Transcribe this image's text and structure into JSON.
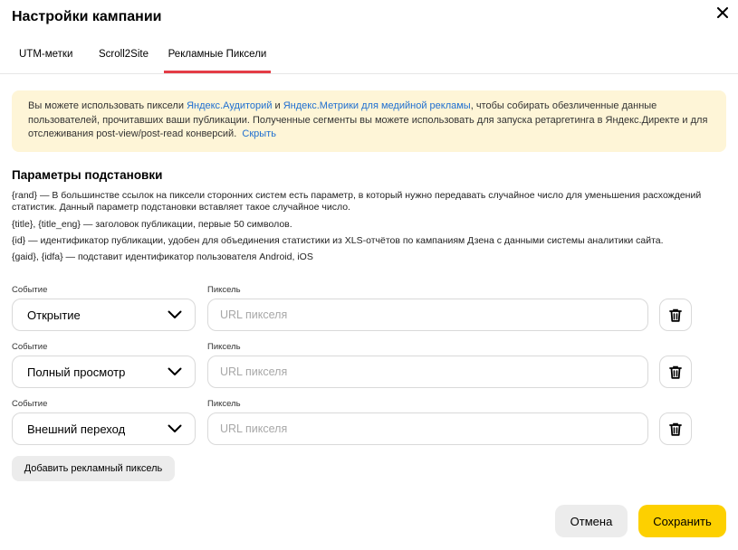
{
  "dialog": {
    "title": "Настройки кампании",
    "close_icon": "close-icon"
  },
  "tabs": [
    {
      "label": "UTM-метки",
      "active": false
    },
    {
      "label": "Scroll2Site",
      "active": false
    },
    {
      "label": "Рекламные Пиксели",
      "active": true
    }
  ],
  "info": {
    "text_1": "Вы можете использовать пиксели ",
    "link_audiences": "Яндекс.Аудиторий",
    "text_2": " и ",
    "link_metrika": "Яндекс.Метрики для медийной рекламы",
    "text_3": ", чтобы собирать обезличенные данные пользователей, прочитавших ваши публикации. Полученные сегменты вы можете использовать для запуска ретаргетинга в Яндекс.Директе и для отслеживания post-view/post-read конверсий.",
    "link_hide": "Скрыть",
    "background_color": "#fef5d7",
    "link_color": "#1f6fd0"
  },
  "params": {
    "title": "Параметры подстановки",
    "lines": [
      "{rand} — В большинстве ссылок на пиксели сторонних систем есть параметр, в который нужно передавать случайное число для уменьшения расхождений статистик. Данный параметр подстановки вставляет такое случайное число.",
      "{title}, {title_eng} — заголовок публикации, первые 50 символов.",
      "{id} — идентификатор публикации, удобен для объединения статистики из XLS-отчётов по кампаниям Дзена с данными системы аналитики сайта.",
      "{gaid}, {idfa} — подставит идентификатор пользователя Android, iOS"
    ]
  },
  "pixels": [
    {
      "event_label": "Событие",
      "event_value": "Открытие",
      "pixel_label": "Пиксель",
      "pixel_placeholder": "URL пикселя",
      "pixel_value": ""
    },
    {
      "event_label": "Событие",
      "event_value": "Полный просмотр",
      "pixel_label": "Пиксель",
      "pixel_placeholder": "URL пикселя",
      "pixel_value": ""
    },
    {
      "event_label": "Событие",
      "event_value": "Внешний переход",
      "pixel_label": "Пиксель",
      "pixel_placeholder": "URL пикселя",
      "pixel_value": ""
    }
  ],
  "actions": {
    "add_pixel": "Добавить рекламный пиксель",
    "cancel": "Отмена",
    "save": "Сохранить",
    "save_color": "#fdd000",
    "tab_accent_color": "#e43c46"
  }
}
